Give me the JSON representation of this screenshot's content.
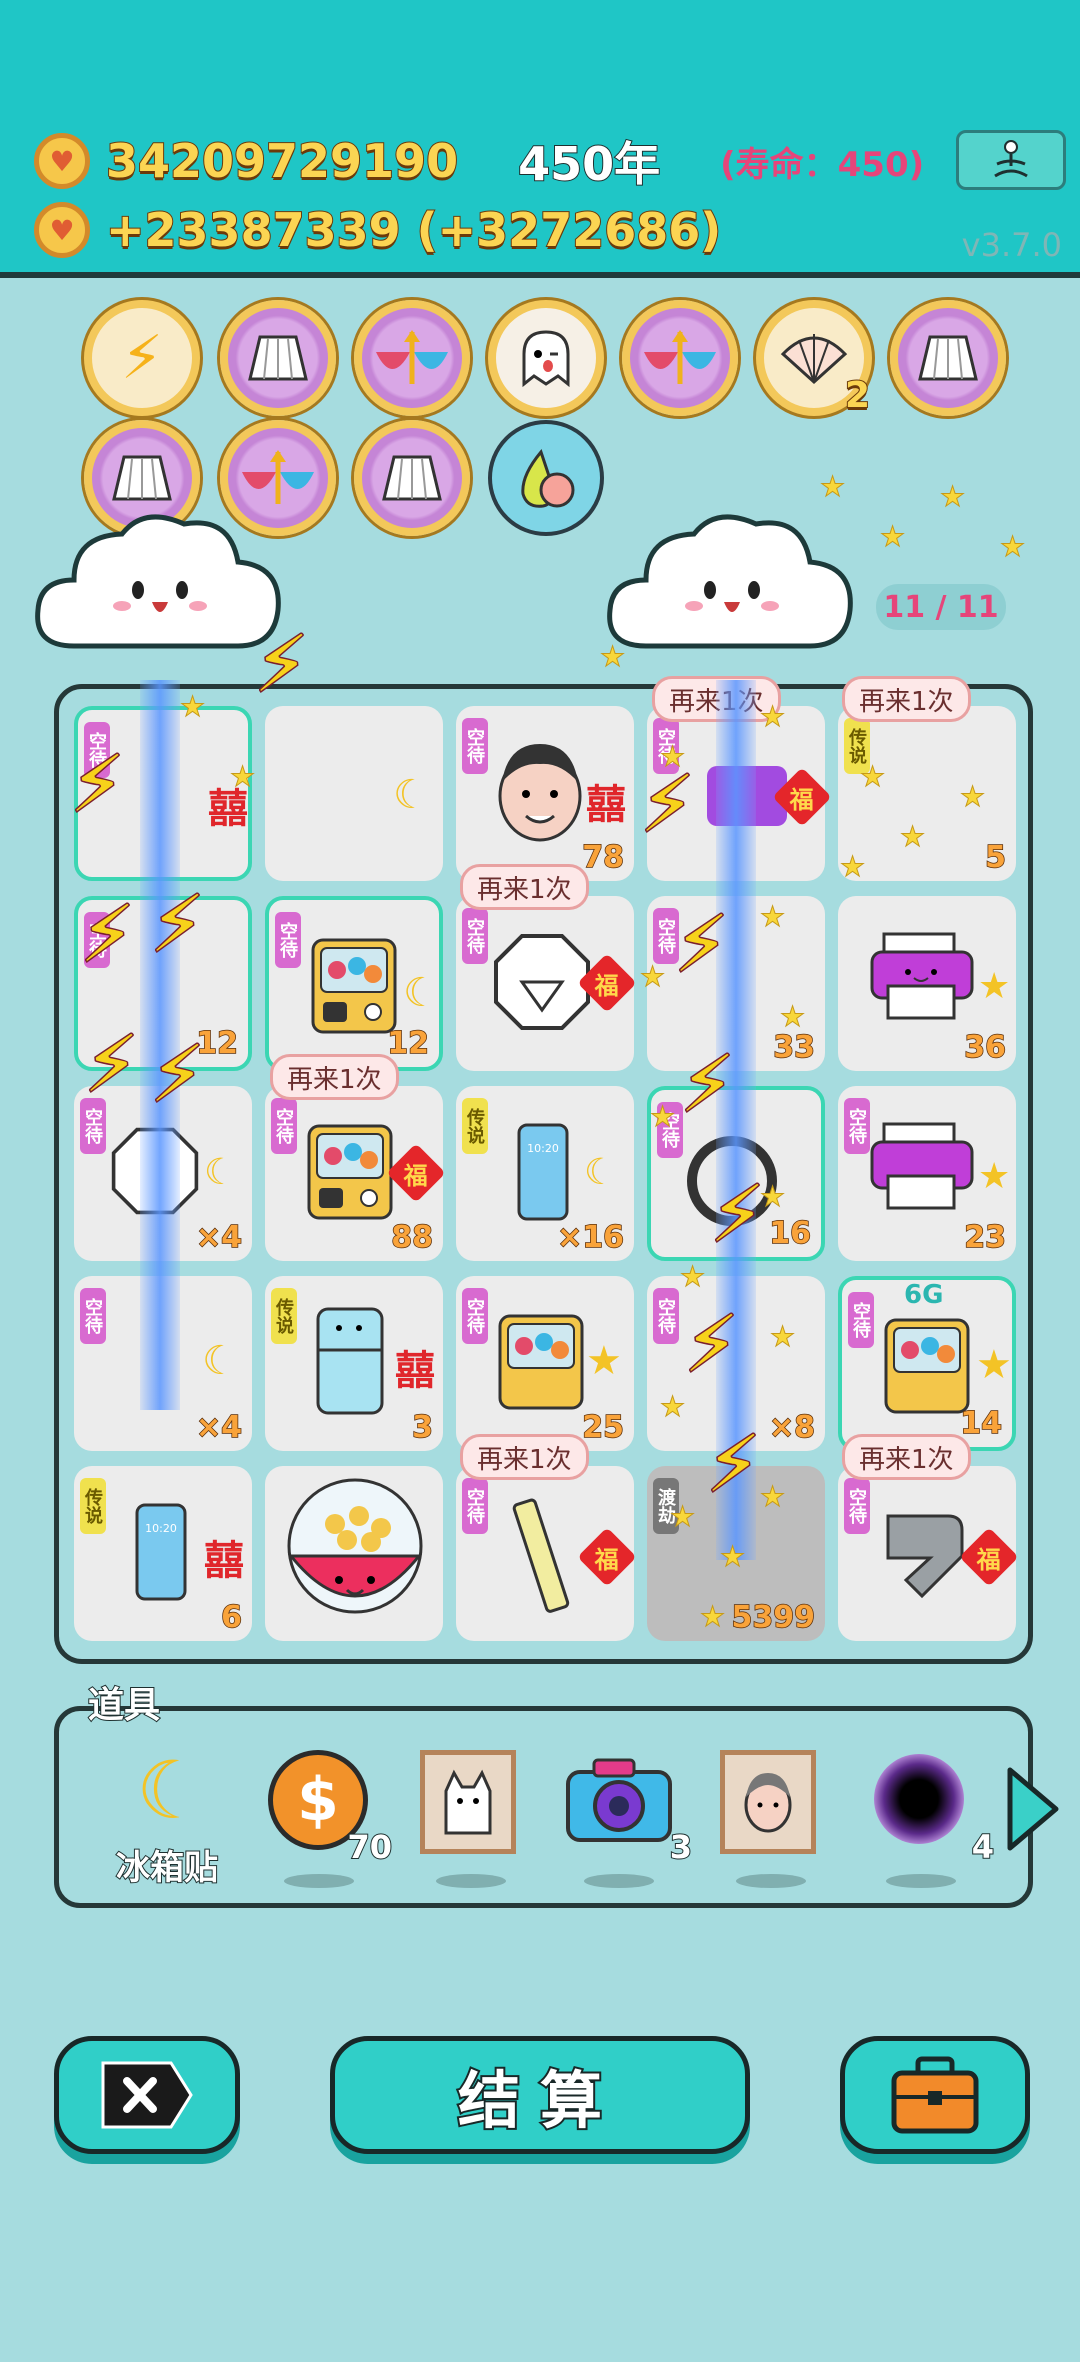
{
  "header": {
    "coins": "34209729190",
    "year": "450年",
    "lifespan": "(寿命：450)",
    "income": "+23387339 (+3272686)",
    "version": "v3.7.0"
  },
  "board": {
    "counter": "11 / 11",
    "retry_label": "再来1次",
    "tags": {
      "empty": "空待",
      "legend": "传说",
      "sleep": "渡劫"
    },
    "counts": [
      "78",
      "5",
      "12",
      "12",
      "33",
      "36",
      "×4",
      "88",
      "×16",
      "16",
      "23",
      "×4",
      "3",
      "25",
      "×8",
      "14",
      "6",
      "5399"
    ],
    "network_label": "6G"
  },
  "items": {
    "title": "道具",
    "sticker_label": "冰箱贴",
    "coin_count": "70",
    "camera_count": "3",
    "blackhole_count": "4"
  },
  "buttons": {
    "settle": "结算"
  },
  "icons": {
    "coin": "coin-icon",
    "meditate": "meditate-icon",
    "close": "close-icon",
    "briefcase": "briefcase-icon",
    "arrow": "arrow-right-icon"
  },
  "colors": {
    "header_bg": "#1fc6c6",
    "page_bg": "#a6dcdf",
    "gold_text": "#fbd553",
    "pink_text": "#e6457a"
  }
}
